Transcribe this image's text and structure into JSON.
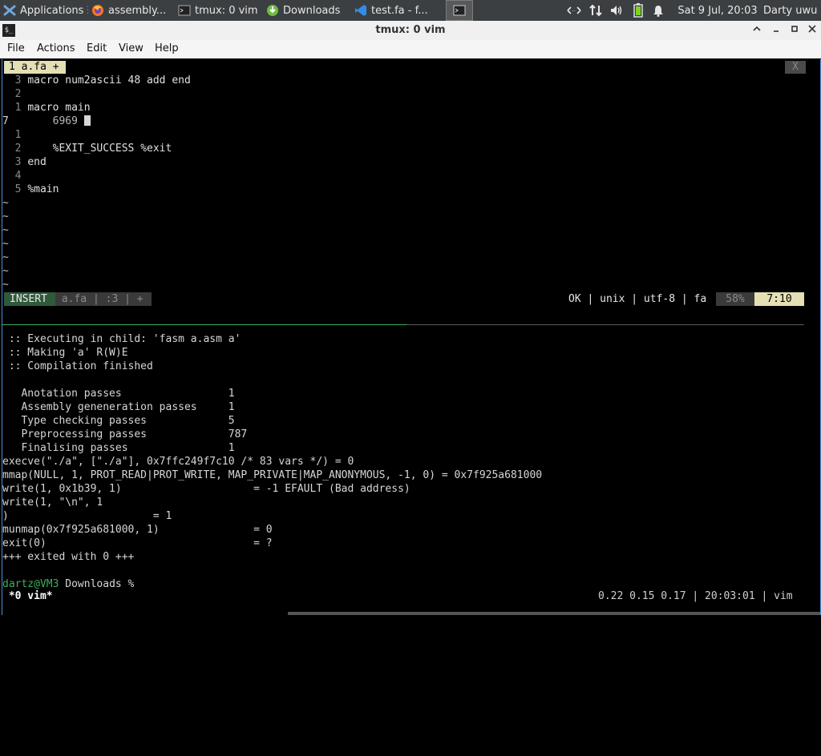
{
  "panel": {
    "tasks": [
      {
        "label": "Applications ☰",
        "icon": "xfce-mouse-icon"
      },
      {
        "label": "assembly...",
        "icon": "firefox-icon"
      },
      {
        "label": "tmux: 0 vim",
        "icon": "terminal-icon"
      },
      {
        "label": "Downloads",
        "icon": "download-icon"
      },
      {
        "label": "test.fa - f...",
        "icon": "vscode-icon"
      },
      {
        "label": "",
        "icon": "terminal-icon"
      }
    ],
    "tray": {
      "network_icon": "network-arrows-icon",
      "transfer_icon": "updown-arrows-icon",
      "volume_icon": "speaker-icon",
      "battery_icon": "battery-icon",
      "bell_icon": "bell-icon",
      "clock": "Sat  9 Jul, 20:03",
      "user": "Darty uwu"
    }
  },
  "window": {
    "title": "tmux: 0 vim",
    "minimize": "⌃",
    "restore": "–",
    "maximize": "▫",
    "close": "✕"
  },
  "menu": [
    "File",
    "Actions",
    "Edit",
    "View",
    "Help"
  ],
  "vim": {
    "buffer_tab": "1 a.fa +",
    "buffer_close": "X",
    "lines": [
      {
        "nr": "3",
        "text": "macro num2ascii 48 add end"
      },
      {
        "nr": "2",
        "text": ""
      },
      {
        "nr": "1",
        "text": "macro main"
      },
      {
        "nr": "7",
        "text": "    6969 ",
        "current": true
      },
      {
        "nr": "1",
        "text": ""
      },
      {
        "nr": "2",
        "text": "    %EXIT_SUCCESS %exit"
      },
      {
        "nr": "3",
        "text": "end"
      },
      {
        "nr": "4",
        "text": ""
      },
      {
        "nr": "5",
        "text": "%main"
      }
    ],
    "tilde_count": 7,
    "status": {
      "mode": "INSERT",
      "file": "a.fa",
      "sep1": "|",
      "pos": ":3",
      "sep2": "|",
      "modified": "+",
      "right_info": "OK | unix | utf-8 | fa",
      "percent": "58%",
      "cursor": "7:10"
    }
  },
  "output": [
    " :: Executing in child: 'fasm a.asm a'",
    " :: Making 'a' R(W)E",
    " :: Compilation finished",
    "",
    "   Anotation passes                 1",
    "   Assembly geneneration passes     1",
    "   Type checking passes             5",
    "   Preprocessing passes             787",
    "   Finalising passes                1",
    "execve(\"./a\", [\"./a\"], 0x7ffc249f7c10 /* 83 vars */) = 0",
    "mmap(NULL, 1, PROT_READ|PROT_WRITE, MAP_PRIVATE|MAP_ANONYMOUS, -1, 0) = 0x7f925a681000",
    "write(1, 0x1b39, 1)                     = -1 EFAULT (Bad address)",
    "write(1, \"\\n\", 1",
    ")                       = 1",
    "munmap(0x7f925a681000, 1)               = 0",
    "exit(0)                                 = ?",
    "+++ exited with 0 +++",
    ""
  ],
  "prompt": {
    "user_host": "dartz@VM3",
    "rest": " Downloads % "
  },
  "tmux": {
    "window": " *0 vim*",
    "right": "0.22 0.15 0.17 | 20:03:01 | vim"
  },
  "colors": {
    "panel_bg": "#3c3f41",
    "accent_blue": "#4a90d9",
    "buffer_tab": "#e4e0b4",
    "insert_bg": "#2f5a3a",
    "prompt_green": "#3fae5a",
    "cursor_pos_bg": "#e4e0b4"
  }
}
